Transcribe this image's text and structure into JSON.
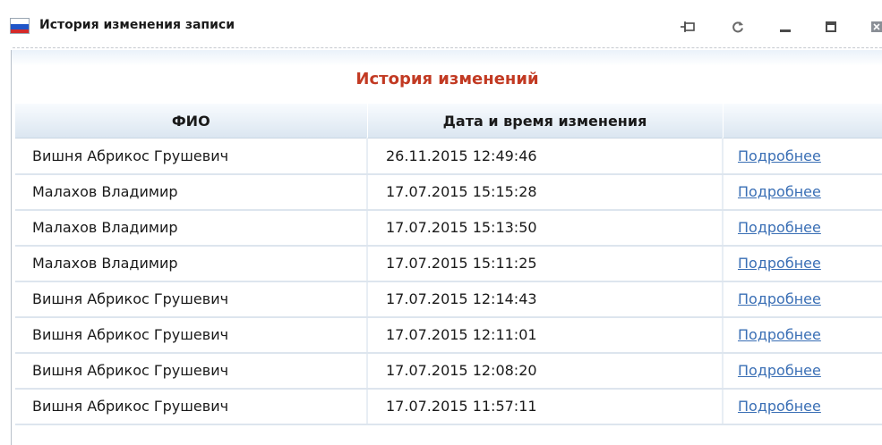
{
  "window": {
    "title": "История изменения записи"
  },
  "heading": "История изменений",
  "table": {
    "columns": [
      "ФИО",
      "Дата и время изменения",
      ""
    ],
    "rows": [
      {
        "fio": "Вишня Абрикос Грушевич",
        "datetime": "26.11.2015 12:49:46",
        "link": "Подробнее"
      },
      {
        "fio": "Малахов Владимир",
        "datetime": "17.07.2015 15:15:28",
        "link": "Подробнее"
      },
      {
        "fio": "Малахов Владимир",
        "datetime": "17.07.2015 15:13:50",
        "link": "Подробнее"
      },
      {
        "fio": "Малахов Владимир",
        "datetime": "17.07.2015 15:11:25",
        "link": "Подробнее"
      },
      {
        "fio": "Вишня Абрикос Грушевич",
        "datetime": "17.07.2015 12:14:43",
        "link": "Подробнее"
      },
      {
        "fio": "Вишня Абрикос Грушевич",
        "datetime": "17.07.2015 12:11:01",
        "link": "Подробнее"
      },
      {
        "fio": "Вишня Абрикос Грушевич",
        "datetime": "17.07.2015 12:08:20",
        "link": "Подробнее"
      },
      {
        "fio": "Вишня Абрикос Грушевич",
        "datetime": "17.07.2015 11:57:11",
        "link": "Подробнее"
      }
    ]
  },
  "toolbar_icons": [
    "pin-icon",
    "refresh-icon",
    "minimize-icon",
    "maximize-icon",
    "close-icon"
  ],
  "colors": {
    "heading": "#c23a23",
    "link": "#3a6fb5",
    "header_bg": "#dbe6f1"
  }
}
